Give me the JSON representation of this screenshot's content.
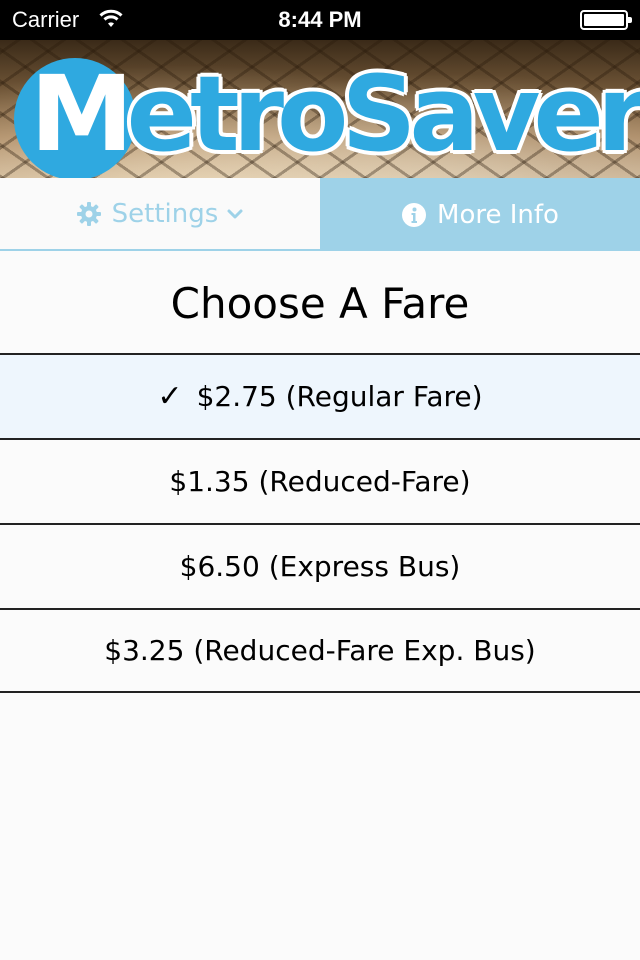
{
  "status_bar": {
    "carrier": "Carrier",
    "time": "8:44 PM",
    "battery_level": 1.0
  },
  "header": {
    "logo_first_letter": "M",
    "logo_rest": "etroSaver",
    "logo_color": "#2fa9e0"
  },
  "tabs": [
    {
      "label": "Settings",
      "icon": "gear-icon",
      "dropdown_icon": "chevron-down-icon"
    },
    {
      "label": "More Info",
      "icon": "info-icon"
    }
  ],
  "title": "Choose A Fare",
  "fares": [
    {
      "label": "$2.75 (Regular Fare)",
      "selected": true,
      "check": "✓"
    },
    {
      "label": "$1.35 (Reduced-Fare)",
      "selected": false
    },
    {
      "label": "$6.50 (Express Bus)",
      "selected": false
    },
    {
      "label": "$3.25 (Reduced-Fare Exp. Bus)",
      "selected": false
    }
  ],
  "colors": {
    "accent": "#9ed2e8",
    "selected_row": "#eef6fd"
  }
}
